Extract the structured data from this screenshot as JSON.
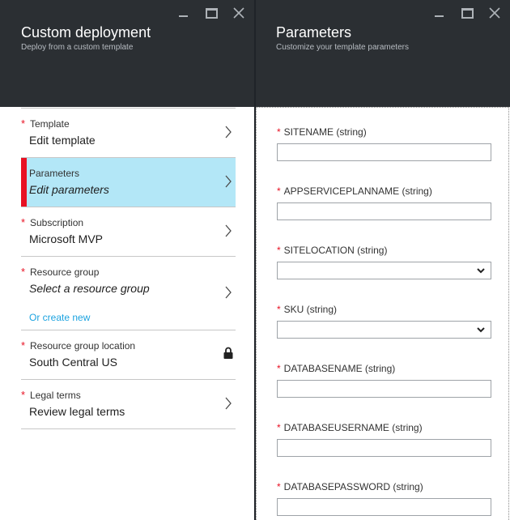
{
  "left_blade": {
    "title": "Custom deployment",
    "subtitle": "Deploy from a custom template",
    "steps": [
      {
        "label": "Template",
        "value": "Edit template",
        "required": "*"
      },
      {
        "label": "Parameters",
        "value": "Edit parameters"
      },
      {
        "label": "Subscription",
        "value": "Microsoft MVP",
        "required": "*"
      },
      {
        "label": "Resource group",
        "value": "Select a resource group",
        "required": "*",
        "link": "Or create new"
      },
      {
        "label": "Resource group location",
        "value": "South Central US",
        "required": "*"
      },
      {
        "label": "Legal terms",
        "value": "Review legal terms",
        "required": "*"
      }
    ]
  },
  "right_blade": {
    "title": "Parameters",
    "subtitle": "Customize your template parameters",
    "fields": [
      {
        "label": "SITENAME (string)",
        "value": ""
      },
      {
        "label": "APPSERVICEPLANNAME (string)",
        "value": ""
      },
      {
        "label": "SITELOCATION (string)",
        "value": ""
      },
      {
        "label": "SKU (string)",
        "value": ""
      },
      {
        "label": "DATABASENAME (string)",
        "value": ""
      },
      {
        "label": "DATABASEUSERNAME (string)",
        "value": ""
      },
      {
        "label": "DATABASEPASSWORD (string)",
        "value": ""
      }
    ],
    "required_marker": "*"
  },
  "colors": {
    "header_bg": "#2b2f33",
    "selected_bg": "#b3e7f7",
    "accent_red": "#e81123",
    "link_blue": "#1ca3e0"
  },
  "icons": [
    "minimize-icon",
    "maximize-icon",
    "close-icon",
    "chevron-right-icon",
    "lock-icon",
    "chevron-down-icon"
  ]
}
